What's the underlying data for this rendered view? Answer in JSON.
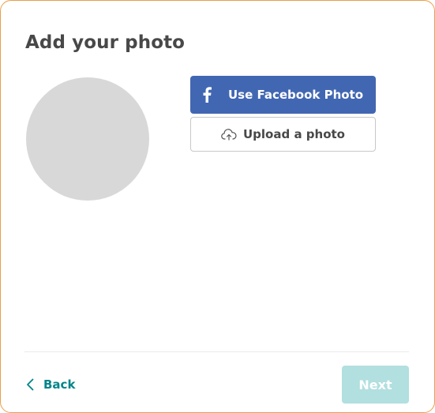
{
  "header": {
    "title": "Add your photo"
  },
  "photo_options": {
    "facebook_label": "Use Facebook Photo",
    "upload_label": "Upload a photo"
  },
  "footer": {
    "back_label": "Back",
    "next_label": "Next"
  },
  "colors": {
    "accent": "#008489",
    "facebook": "#4267b2",
    "next_disabled": "#b2dfdf",
    "card_border": "#e8a04a"
  },
  "icons": {
    "facebook": "facebook-icon",
    "upload": "cloud-upload-icon",
    "back": "chevron-left-icon"
  }
}
